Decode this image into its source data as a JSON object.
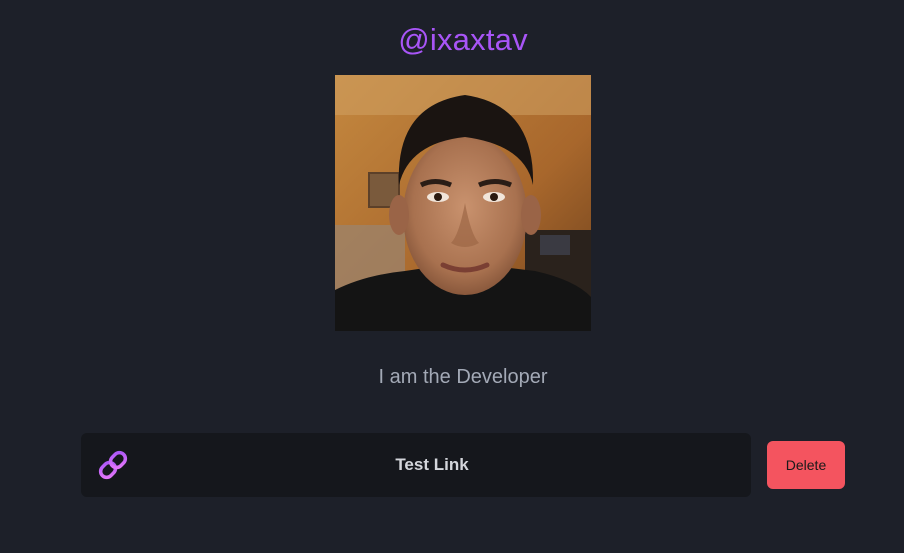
{
  "profile": {
    "username": "@ixaxtav",
    "bio": "I am the Developer"
  },
  "links": [
    {
      "label": "Test Link",
      "icon": "link-icon",
      "delete_label": "Delete"
    }
  ],
  "colors": {
    "background": "#1d2029",
    "accent": "#a855f7",
    "card": "#15171c",
    "danger": "#f4545f"
  }
}
